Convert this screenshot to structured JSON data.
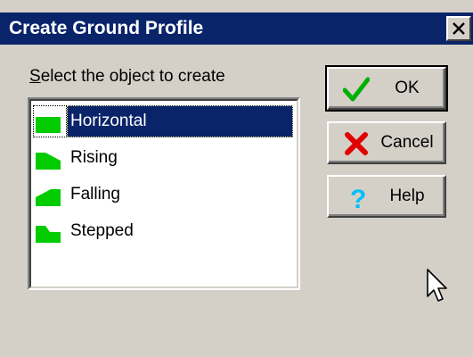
{
  "window": {
    "title": "Create Ground Profile"
  },
  "prompt": {
    "accel": "S",
    "rest": "elect the object to create"
  },
  "list": {
    "items": [
      {
        "label": "Horizontal",
        "icon": "horizontal-profile-icon",
        "selected": true
      },
      {
        "label": "Rising",
        "icon": "rising-profile-icon",
        "selected": false
      },
      {
        "label": "Falling",
        "icon": "falling-profile-icon",
        "selected": false
      },
      {
        "label": "Stepped",
        "icon": "stepped-profile-icon",
        "selected": false
      }
    ]
  },
  "buttons": {
    "ok": {
      "label": "OK",
      "icon": "checkmark-icon"
    },
    "cancel": {
      "label": "Cancel",
      "icon": "red-x-icon"
    },
    "help": {
      "label": "Help",
      "icon": "question-mark-icon"
    }
  },
  "colors": {
    "titlebar": "#0a246a",
    "dialog": "#d4d0c8",
    "selection": "#0a246a",
    "profile_green": "#00cc00"
  }
}
